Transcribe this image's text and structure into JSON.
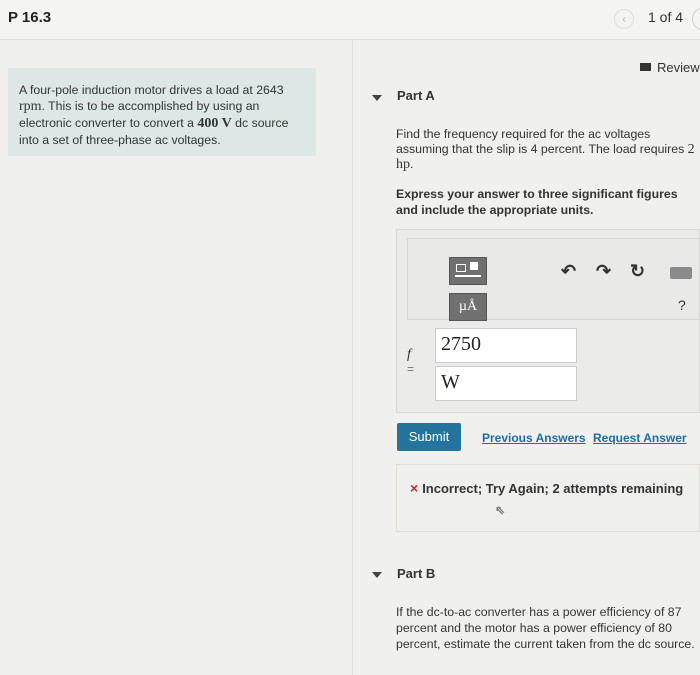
{
  "header": {
    "title": "P 16.3",
    "pager": "1 of 4",
    "prev_icon": "chevron-left-icon",
    "next_icon": "chevron-right-icon"
  },
  "review": {
    "label": "Review"
  },
  "problem": {
    "text_1": "A four-pole induction motor drives a load at 2643 ",
    "unit_rpm": "rpm",
    "text_2": ". This is to be accomplished by using an electronic converter to convert a ",
    "voltage": "400 V",
    "text_3": " dc source into a set of three-phase ac voltages."
  },
  "part_a": {
    "title": "Part A",
    "question_1": "Find the frequency required for the ac voltages assuming that the slip is 4 percent. The load requires ",
    "power": "2 hp",
    "question_2": ".",
    "instruction": "Express your answer to three significant figures and include the appropriate units.",
    "toolbar": {
      "template_icon": "template-icon",
      "unit_label": "µÅ",
      "undo_icon": "undo-icon",
      "redo_icon": "redo-icon",
      "reset_icon": "reset-icon",
      "keyboard_icon": "keyboard-icon",
      "help_label": "?"
    },
    "variable": "f",
    "equals": "=",
    "value": "2750",
    "unit": "W",
    "submit_label": "Submit",
    "previous_answers_label": "Previous Answers",
    "request_answer_label": "Request Answer",
    "feedback": {
      "icon": "×",
      "text": "Incorrect; Try Again; 2 attempts remaining"
    }
  },
  "part_b": {
    "title": "Part B",
    "question": "If the dc-to-ac converter has a power efficiency of 87 percent and the motor has a power efficiency of 80 percent, estimate the current taken from the dc source."
  },
  "colors": {
    "accent": "#24749e",
    "link": "#1d6ea3",
    "problem_bg": "#dde8e6",
    "error": "#c6262e"
  }
}
